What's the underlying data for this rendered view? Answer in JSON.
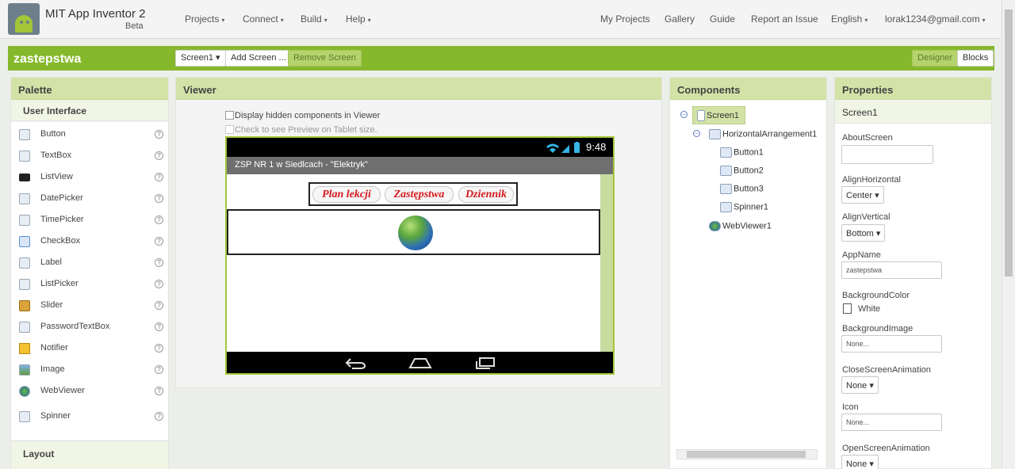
{
  "brand": {
    "title": "MIT App Inventor 2",
    "subtitle": "Beta"
  },
  "nav_left": [
    {
      "label": "Projects",
      "caret": "▾"
    },
    {
      "label": "Connect",
      "caret": "▾"
    },
    {
      "label": "Build",
      "caret": "▾"
    },
    {
      "label": "Help",
      "caret": "▾"
    }
  ],
  "nav_right": [
    {
      "label": "My Projects"
    },
    {
      "label": "Gallery"
    },
    {
      "label": "Guide"
    },
    {
      "label": "Report an Issue"
    },
    {
      "label": "English",
      "caret": "▾"
    },
    {
      "label": "lorak1234@gmail.com",
      "caret": "▾"
    }
  ],
  "project": {
    "name": "zastepstwa",
    "screen_select": "Screen1 ▾",
    "add_screen": "Add Screen ...",
    "remove_screen": "Remove Screen",
    "designer": "Designer",
    "blocks": "Blocks"
  },
  "palette": {
    "title": "Palette",
    "category": "User Interface",
    "items": [
      {
        "label": "Button",
        "icon": "button-icon"
      },
      {
        "label": "TextBox",
        "icon": "textbox-icon"
      },
      {
        "label": "ListView",
        "icon": "listview-icon"
      },
      {
        "label": "DatePicker",
        "icon": "datepicker-icon"
      },
      {
        "label": "TimePicker",
        "icon": "timepicker-icon"
      },
      {
        "label": "CheckBox",
        "icon": "checkbox-icon"
      },
      {
        "label": "Label",
        "icon": "label-icon"
      },
      {
        "label": "ListPicker",
        "icon": "listpicker-icon"
      },
      {
        "label": "Slider",
        "icon": "slider-icon"
      },
      {
        "label": "PasswordTextBox",
        "icon": "passwordtextbox-icon"
      },
      {
        "label": "Notifier",
        "icon": "notifier-icon"
      },
      {
        "label": "Image",
        "icon": "image-icon"
      },
      {
        "label": "WebViewer",
        "icon": "webviewer-icon"
      },
      {
        "label": "Spinner",
        "icon": "spinner-icon"
      }
    ],
    "help_glyph": "?",
    "layout": "Layout"
  },
  "viewer": {
    "title": "Viewer",
    "display_hidden": "Display hidden components in Viewer",
    "tablet_preview": "Check to see Preview on Tablet size.",
    "time": "9:48",
    "app_title": "ZSP NR 1 w Siedlcach - \"Elektryk\"",
    "buttons": [
      "Plan lekcji",
      "Zastępstwa",
      "Dziennik"
    ]
  },
  "components": {
    "title": "Components",
    "tree": [
      {
        "label": "Screen1",
        "toggle": "−"
      },
      {
        "label": "HorizontalArrangement1",
        "toggle": "−"
      },
      {
        "label": "Button1"
      },
      {
        "label": "Button2"
      },
      {
        "label": "Button3"
      },
      {
        "label": "Spinner1"
      },
      {
        "label": "WebViewer1"
      }
    ]
  },
  "properties": {
    "title": "Properties",
    "screen": "Screen1",
    "about_screen": {
      "label": "AboutScreen",
      "value": ""
    },
    "align_horizontal": {
      "label": "AlignHorizontal",
      "value": "Center ▾"
    },
    "align_vertical": {
      "label": "AlignVertical",
      "value": "Bottom ▾"
    },
    "app_name": {
      "label": "AppName",
      "value": "zastepstwa"
    },
    "background_color": {
      "label": "BackgroundColor",
      "value": "White",
      "color": "#ffffff"
    },
    "background_image": {
      "label": "BackgroundImage",
      "value": "None..."
    },
    "close_screen_animation": {
      "label": "CloseScreenAnimation",
      "value": "None ▾"
    },
    "icon": {
      "label": "Icon",
      "value": "None..."
    },
    "open_screen_animation": {
      "label": "OpenScreenAnimation",
      "value": "None ▾"
    }
  },
  "colors": {
    "accent_green": "#86b82c",
    "panel_header": "#d3e3a7",
    "button_text_red": "#d4181e"
  }
}
